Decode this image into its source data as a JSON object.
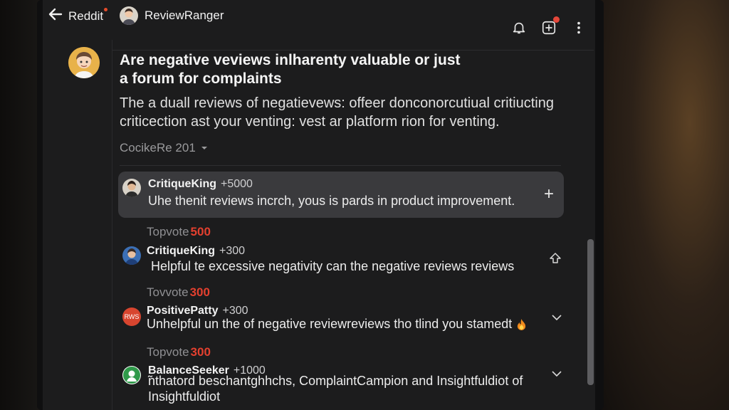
{
  "topbar": {
    "back_label": "Reddit",
    "username": "ReviewRanger"
  },
  "post": {
    "title_line1": "Are negative veviews inlharenty valuable or just",
    "title_line2": "a forum for complaints",
    "body_line1": "The a duall reviews of negatievews: offeer donconorcutiual critiucting",
    "body_line2": "criticection ast your venting: vest ar platform rion for venting.",
    "sort_label": "CocikeRe 201"
  },
  "highlight_comment": {
    "author": "CritiqueKing",
    "score": "+5000",
    "text": "Uhe thenit reviews incrch, yous is pards in product improvement."
  },
  "comments": [
    {
      "topvote_label": "Topvote",
      "topvote_num": "500",
      "author": "CritiqueKing",
      "score": "+300",
      "text": "Helpful te excessive negativity can the negative reviews reviews"
    },
    {
      "topvote_label": "Tovvote",
      "topvote_num": "300",
      "author": "PositivePatty",
      "score": "+300",
      "text": "Unhelpful un the of negative reviewreviews tho tlind you stamedt",
      "avatar_text": "RWS"
    },
    {
      "topvote_label": "Topvote",
      "topvote_num": "300",
      "author": "BalanceSeeker",
      "score": "+1000",
      "text_line1": "̃nthatord beschantghhchs, ComplaintCampion and Insightfuldiot of",
      "text_line2": "Insightfuldiot"
    }
  ],
  "colors": {
    "accent_red": "#e3402f",
    "card_bg": "#3a3a3d",
    "screen_bg": "#1c1c1d"
  },
  "icons": [
    "back-arrow-icon",
    "bell-icon",
    "create-post-icon",
    "more-options-icon",
    "chevron-down-icon",
    "plus-icon",
    "upvote-icon",
    "fire-icon"
  ]
}
